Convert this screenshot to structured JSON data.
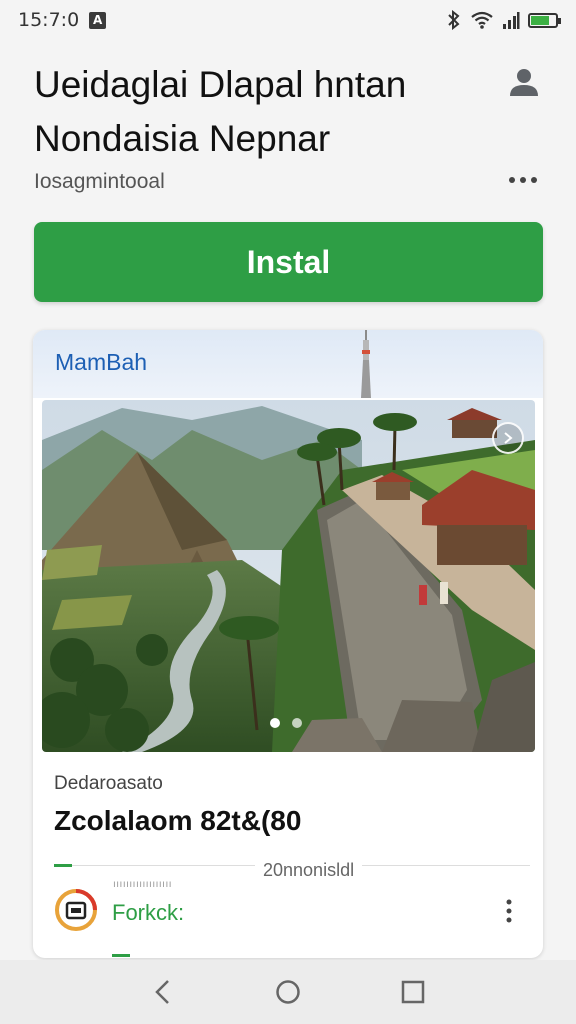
{
  "status_bar": {
    "time": "15:7:0",
    "notification_icon": "A"
  },
  "header": {
    "title_line1": "Ueidaglai Dlapal hntan",
    "title_line2": "Nondaisia Nepnar",
    "subtitle": "Iosagmintooal",
    "install_label": "Instal"
  },
  "card": {
    "title": "MamBah",
    "label": "Dedaroasato",
    "value": "Zcolalaom 82t&(80",
    "divider_caption": "20nnonisldl",
    "footer_tiny_text": "ıııııııııııııııııı",
    "footer_app_name": "Forkck:"
  },
  "colors": {
    "accent_green": "#2e9e45",
    "link_blue": "#1d5fb4"
  },
  "icons": {
    "avatar": "person-icon",
    "more": "more-horizontal-icon",
    "next": "chevron-right-icon",
    "app": "app-logo-icon",
    "nav_back": "back-icon",
    "nav_home": "home-icon",
    "nav_recents": "recents-icon"
  }
}
